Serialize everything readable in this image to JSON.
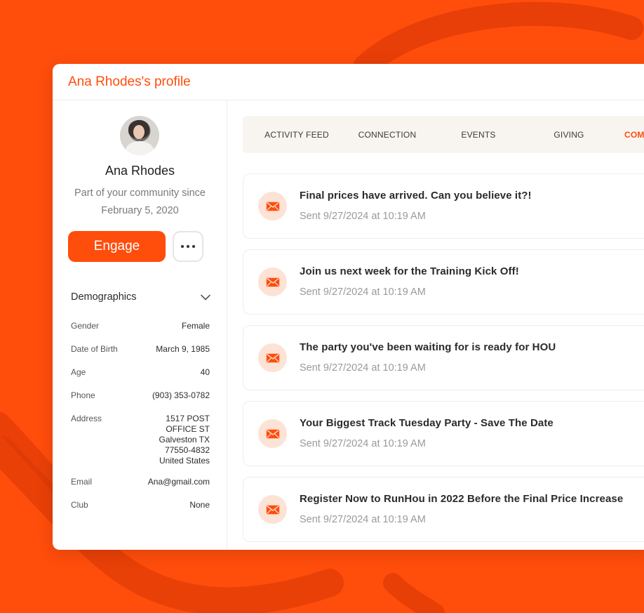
{
  "colors": {
    "accent": "#FF4D0C",
    "background": "#FF4D0C",
    "mail_icon_bg": "#FDE2D6",
    "tab_bar_bg": "#F8F4F0"
  },
  "header": {
    "title": "Ana Rhodes's profile"
  },
  "profile": {
    "name": "Ana Rhodes",
    "member_since_line1": "Part of your community since",
    "member_since_line2": "February 5, 2020",
    "engage_label": "Engage",
    "more_icon": "more-horizontal-icon"
  },
  "demographics": {
    "title": "Demographics",
    "toggle_icon": "chevron-down-icon",
    "rows": [
      {
        "label": "Gender",
        "value": "Female"
      },
      {
        "label": "Date of Birth",
        "value": "March 9, 1985"
      },
      {
        "label": "Age",
        "value": "40"
      },
      {
        "label": "Phone",
        "value": "(903) 353-0782"
      },
      {
        "label": "Address",
        "lines": [
          "1517 POST",
          "OFFICE ST",
          "Galveston TX",
          "77550-4832",
          "United States"
        ]
      },
      {
        "label": "Email",
        "value": "Ana@gmail.com"
      },
      {
        "label": "Club",
        "value": "None"
      }
    ]
  },
  "tabs": [
    {
      "label": "ACTIVITY FEED"
    },
    {
      "label": "CONNECTION"
    },
    {
      "label": "EVENTS"
    },
    {
      "label": "GIVING"
    },
    {
      "label": "COM",
      "active": true
    }
  ],
  "messages": [
    {
      "icon": "mail-icon",
      "title": "Final prices have arrived. Can you believe it?!",
      "sent": "Sent 9/27/2024 at 10:19 AM"
    },
    {
      "icon": "mail-icon",
      "title": "Join us next week for the Training Kick Off!",
      "sent": "Sent 9/27/2024 at 10:19 AM"
    },
    {
      "icon": "mail-icon",
      "title": "The party you've been waiting for is ready for HOU",
      "sent": "Sent 9/27/2024 at 10:19 AM"
    },
    {
      "icon": "mail-icon",
      "title": "Your Biggest Track Tuesday Party - Save The Date",
      "sent": "Sent 9/27/2024 at 10:19 AM"
    },
    {
      "icon": "mail-icon",
      "title": "Register Now to RunHou in 2022 Before the Final Price Increase",
      "sent": "Sent 9/27/2024 at 10:19 AM"
    }
  ]
}
